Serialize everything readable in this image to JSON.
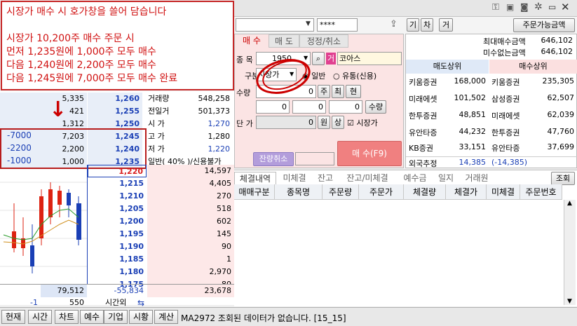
{
  "annotation": {
    "lines": [
      "시장가 매수 시 호가창을 쓸어 담습니다",
      "",
      "시장가 10,200주 매수 주문 시",
      "먼저 1,235원에 1,000주 모두 매수",
      "다음 1,240원에 2,200주 모두 매수",
      "다음 1,245원에 7,000주 모두 매수 완료"
    ],
    "arrow": "↓",
    "marks": [
      "-7000",
      "-2200",
      "-1000"
    ]
  },
  "topbar": {
    "password_value": "****",
    "icons": [
      "key-icon",
      "memo-icon",
      "camera-icon",
      "gear-icon"
    ],
    "btn_gi": "기",
    "btn_cha": "차",
    "btn_geo": "거",
    "avail_btn": "주문가능금액"
  },
  "book": {
    "asks": [
      {
        "qty": "5,335",
        "price": "1,260",
        "label": "거래량",
        "val": "548,258"
      },
      {
        "qty": "421",
        "price": "1,255",
        "label": "전일거",
        "val": "501,373"
      },
      {
        "qty": "1,312",
        "price": "1,250",
        "label": "시 가",
        "val": "1,270"
      },
      {
        "qty": "7,203",
        "price": "1,245",
        "label": "고 가",
        "val": "1,280"
      },
      {
        "qty": "2,200",
        "price": "1,240",
        "label": "저 가",
        "val": "1,220"
      },
      {
        "qty": "1,000",
        "price": "1,235",
        "label": "일반( 40% )/신용불가",
        "val": ""
      }
    ],
    "bids": [
      {
        "price": "1,220",
        "qty": "14,597"
      },
      {
        "price": "1,215",
        "qty": "4,405"
      },
      {
        "price": "1,210",
        "qty": "270"
      },
      {
        "price": "1,205",
        "qty": "518"
      },
      {
        "price": "1,200",
        "qty": "602"
      },
      {
        "price": "1,195",
        "qty": "145"
      },
      {
        "price": "1,190",
        "qty": "90"
      },
      {
        "price": "1,185",
        "qty": "1"
      },
      {
        "price": "1,180",
        "qty": "2,970"
      },
      {
        "price": "1,175",
        "qty": "80"
      }
    ],
    "total_ask": "79,512",
    "diff": "-55,834",
    "total_bid": "23,678",
    "after_left": "-1",
    "after_mid": "550",
    "after_label": "시간외"
  },
  "order": {
    "tabs": [
      "매 수",
      "매 도",
      "정정/취소"
    ],
    "code_label": "종 목",
    "code_value": "1950",
    "market_badge": "거",
    "market_name": "코아스",
    "type_label": "구분",
    "type_value": "시장가",
    "radio_general": "일반",
    "radio_credit": "유통(신용)",
    "qty_label": "수량",
    "qty_value": "0",
    "btn_ju": "주",
    "btn_choe": "최",
    "btn_hyeon": "현",
    "row3": [
      "0",
      "0",
      "0"
    ],
    "btn_qty": "수량",
    "price_label": "단 가",
    "price_value": "0",
    "btn_won": "원",
    "btn_sang": "상",
    "market_price_check": "시장가",
    "cancel_remain": "잔량취소",
    "buy_btn": "매 수(F9)"
  },
  "right": {
    "max_buy_label": "최대매수금액",
    "max_buy_val": "646,102",
    "unfilled_label": "미수없는금액",
    "unfilled_val": "646,102",
    "sell_top_label": "매도상위",
    "buy_top_label": "매수상위",
    "rows": [
      {
        "sname": "키움증권",
        "sval": "168,000",
        "bname": "키움증권",
        "bval": "235,305"
      },
      {
        "sname": "미래에셋",
        "sval": "101,502",
        "bname": "삼성증권",
        "bval": "62,507"
      },
      {
        "sname": "한투증권",
        "sval": "48,851",
        "bname": "미래에셋",
        "bval": "62,039"
      },
      {
        "sname": "유안타증",
        "sval": "44,232",
        "bname": "한투증권",
        "bval": "47,760"
      },
      {
        "sname": "KB증권",
        "sval": "33,151",
        "bname": "유안타증",
        "bval": "37,699"
      }
    ],
    "foreign_label": "외국추정",
    "foreign_val": "14,385",
    "foreign_val2": "(-14,385)"
  },
  "bottom": {
    "tabs": [
      "체결내역",
      "미체결",
      "잔고",
      "잔고/미체결",
      "예수금",
      "일지",
      "거래원"
    ],
    "query_btn": "조회",
    "headers": [
      "매매구분",
      "종목명",
      "주문량",
      "주문가",
      "체결량",
      "체결가",
      "미체결",
      "주문번호"
    ]
  },
  "status": {
    "buttons": [
      "현재",
      "시간",
      "차트",
      "예수",
      "기업",
      "시황",
      "계산"
    ],
    "message": "MA2972 조회된 데이터가 없습니다. [15_15]"
  }
}
